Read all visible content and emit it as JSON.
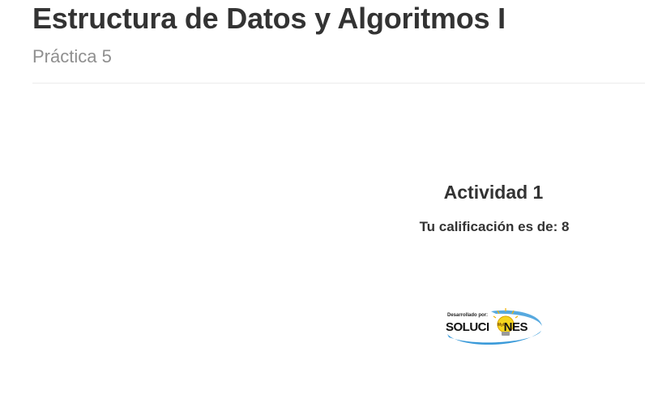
{
  "header": {
    "title": "Estructura de Datos y Algoritmos I",
    "subtitle": "Práctica 5"
  },
  "main": {
    "activity_title": "Actividad 1",
    "grade_text": "Tu calificación es de: 8"
  },
  "footer": {
    "logo": {
      "caption": "Desarrollado por:",
      "word_left": "SOLUCI",
      "word_right": "NES",
      "bulb_text": "MyL",
      "icon": "lightbulb-icon",
      "colors": {
        "swoosh": "#3a9ad9",
        "bulb": "#f5d51e",
        "text": "#111111"
      }
    }
  }
}
